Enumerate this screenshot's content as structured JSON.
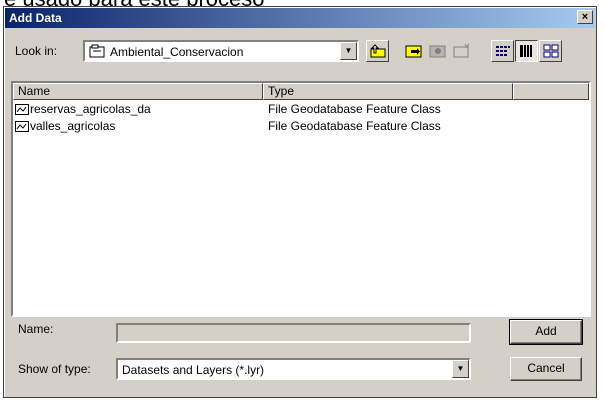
{
  "background": {
    "text": "e usado para este proceso"
  },
  "window": {
    "title": "Add Data",
    "close_glyph": "×"
  },
  "look_in": {
    "label": "Look in:",
    "value": "Ambiental_Conservacion",
    "icon": "folder-icon"
  },
  "toolbar": {
    "buttons": [
      {
        "name": "up-one-level-icon"
      },
      {
        "name": "connect-to-folder-icon"
      },
      {
        "name": "disconnect-from-folder-icon"
      },
      {
        "name": "new-folder-icon"
      },
      {
        "name": "list-view-icon"
      },
      {
        "name": "details-view-icon"
      },
      {
        "name": "thumbnails-view-icon"
      }
    ]
  },
  "list": {
    "columns": [
      "Name",
      "Type"
    ],
    "rows": [
      {
        "name": "reservas_agricolas_da",
        "type": "File Geodatabase Feature Class"
      },
      {
        "name": "valles_agricolas",
        "type": "File Geodatabase Feature Class"
      }
    ]
  },
  "name_field": {
    "label": "Name:",
    "value": ""
  },
  "show_of_type": {
    "label": "Show of type:",
    "value": "Datasets and Layers (*.lyr)"
  },
  "buttons": {
    "add": "Add",
    "cancel": "Cancel"
  }
}
